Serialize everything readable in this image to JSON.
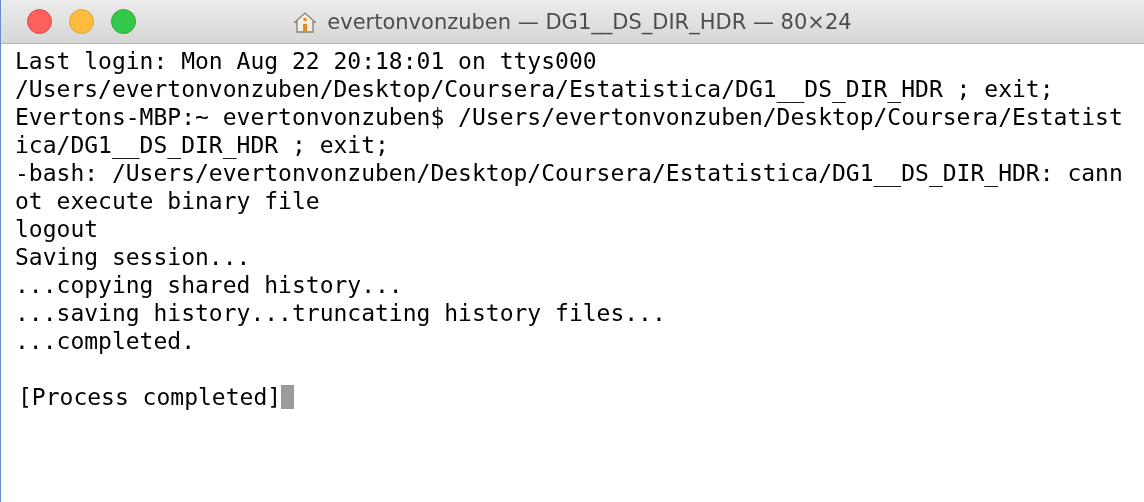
{
  "window": {
    "title": "evertonvonzuben — DG1__DS_DIR_HDR — 80×24"
  },
  "terminal": {
    "lines": [
      {
        "text": "Last login: Mon Aug 22 20:18:01 on ttys000"
      },
      {
        "text": "/Users/evertonvonzuben/Desktop/Coursera/Estatistica/DG1__DS_DIR_HDR ; exit;"
      },
      {
        "text": "Evertons-MBP:~ evertonvonzuben$ /Users/evertonvonzuben/Desktop/Coursera/Estatist"
      },
      {
        "text": "ica/DG1__DS_DIR_HDR ; exit;"
      },
      {
        "text": "-bash: /Users/evertonvonzuben/Desktop/Coursera/Estatistica/DG1__DS_DIR_HDR: cann"
      },
      {
        "text": "ot execute binary file"
      },
      {
        "text": "logout"
      },
      {
        "text": "Saving session..."
      },
      {
        "text": "...copying shared history..."
      },
      {
        "text": "...saving history...truncating history files..."
      },
      {
        "text": "...completed."
      },
      {
        "text": "[Process completed]",
        "kind": "status"
      }
    ],
    "cursor": true
  }
}
